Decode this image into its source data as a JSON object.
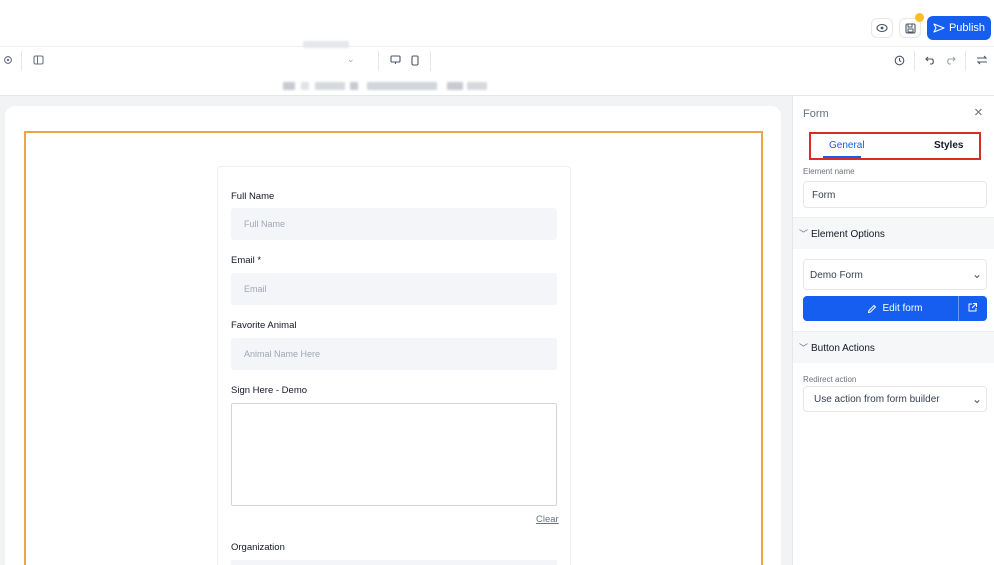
{
  "header": {
    "publish_label": "Publish",
    "icons": [
      "eye-icon",
      "save-icon",
      "send-icon"
    ]
  },
  "toolbar": {
    "icons": [
      "settings-icon",
      "layout-icon",
      "chevron-down-icon",
      "desktop-icon",
      "mobile-icon",
      "history-icon",
      "undo-icon",
      "redo-icon",
      "settings-toggle-icon"
    ]
  },
  "form": {
    "fields": [
      {
        "label": "Full Name",
        "placeholder": "Full Name"
      },
      {
        "label": "Email *",
        "placeholder": "Email"
      },
      {
        "label": "Favorite Animal",
        "placeholder": "Animal Name Here"
      }
    ],
    "signature_label": "Sign Here - Demo",
    "clear_label": "Clear",
    "organization_label": "Organization"
  },
  "panel": {
    "title": "Form",
    "tabs": [
      "General",
      "Styles"
    ],
    "element_name_label": "Element name",
    "element_name_value": "Form",
    "element_options_label": "Element Options",
    "form_select_value": "Demo Form",
    "edit_form_label": "Edit form",
    "button_actions_label": "Button Actions",
    "redirect_action_label": "Redirect action",
    "redirect_action_value": "Use action from form builder"
  },
  "colors": {
    "accent": "#155eef",
    "selection_outline": "#f0a444",
    "highlight_box": "#d92d20",
    "notification_dot": "#fbbf24"
  }
}
